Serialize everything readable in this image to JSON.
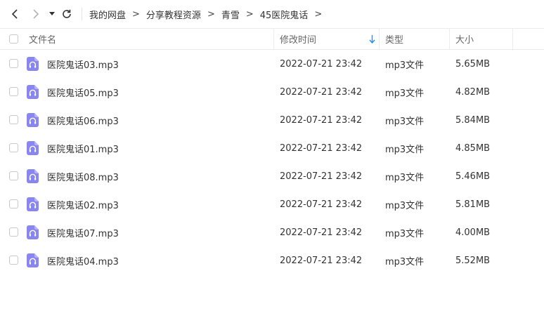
{
  "toolbar": {
    "icons": [
      "back-arrow-icon",
      "forward-arrow-icon",
      "dropdown-caret-icon",
      "refresh-icon"
    ]
  },
  "breadcrumb": [
    "我的网盘",
    "分享教程资源",
    "青雪",
    "45医院鬼话"
  ],
  "breadcrumb_separator": ">",
  "header": {
    "name": "文件名",
    "modified": "修改时间",
    "type": "类型",
    "size": "大小",
    "sort_icon": "sort-down-arrow-icon",
    "accent_color": "#1e90ff"
  },
  "files": [
    {
      "name": "医院鬼话03.mp3",
      "modified": "2022-07-21 23:42",
      "type": "mp3文件",
      "size": "5.65MB"
    },
    {
      "name": "医院鬼话05.mp3",
      "modified": "2022-07-21 23:42",
      "type": "mp3文件",
      "size": "4.82MB"
    },
    {
      "name": "医院鬼话06.mp3",
      "modified": "2022-07-21 23:42",
      "type": "mp3文件",
      "size": "5.84MB"
    },
    {
      "name": "医院鬼话01.mp3",
      "modified": "2022-07-21 23:42",
      "type": "mp3文件",
      "size": "4.85MB"
    },
    {
      "name": "医院鬼话08.mp3",
      "modified": "2022-07-21 23:42",
      "type": "mp3文件",
      "size": "5.46MB"
    },
    {
      "name": "医院鬼话02.mp3",
      "modified": "2022-07-21 23:42",
      "type": "mp3文件",
      "size": "5.81MB"
    },
    {
      "name": "医院鬼话07.mp3",
      "modified": "2022-07-21 23:42",
      "type": "mp3文件",
      "size": "4.00MB"
    },
    {
      "name": "医院鬼话04.mp3",
      "modified": "2022-07-21 23:42",
      "type": "mp3文件",
      "size": "5.52MB"
    }
  ],
  "file_icon": "audio-file-icon",
  "file_icon_color": "#8a86f0"
}
